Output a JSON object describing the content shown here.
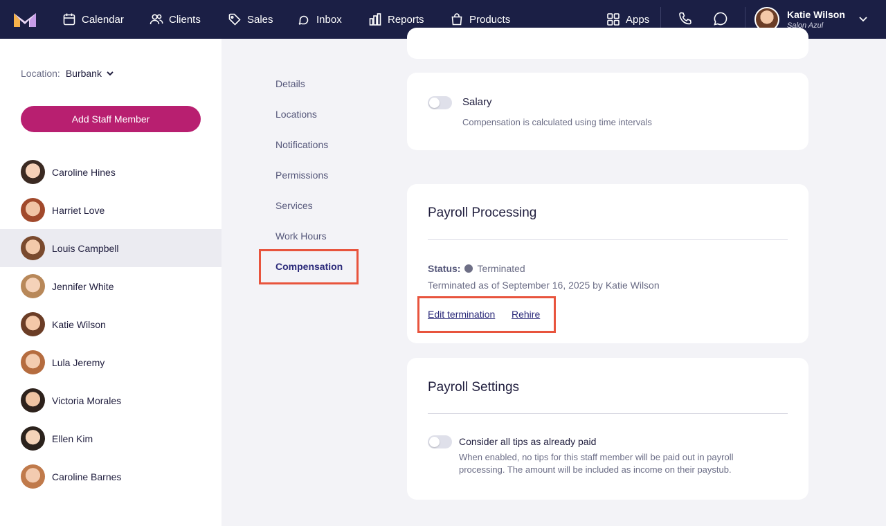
{
  "nav": {
    "items": [
      {
        "label": "Calendar",
        "icon": "calendar-icon"
      },
      {
        "label": "Clients",
        "icon": "clients-icon"
      },
      {
        "label": "Sales",
        "icon": "tag-icon"
      },
      {
        "label": "Inbox",
        "icon": "inbox-icon"
      },
      {
        "label": "Reports",
        "icon": "bar-chart-icon"
      },
      {
        "label": "Products",
        "icon": "shopping-bag-icon"
      }
    ],
    "apps_label": "Apps",
    "user": {
      "name": "Katie Wilson",
      "salon": "Salon Azul"
    }
  },
  "sidebar": {
    "location_label": "Location:",
    "location_value": "Burbank",
    "add_button": "Add Staff Member",
    "staff": [
      {
        "name": "Caroline Hines",
        "active": false,
        "skin": "#f6d1b8",
        "hair": "#3b2a22"
      },
      {
        "name": "Harriet Love",
        "active": false,
        "skin": "#f1c4a5",
        "hair": "#a1492b"
      },
      {
        "name": "Louis Campbell",
        "active": true,
        "skin": "#f3c9aa",
        "hair": "#7a4a2e"
      },
      {
        "name": "Jennifer White",
        "active": false,
        "skin": "#f5d2b9",
        "hair": "#b88859"
      },
      {
        "name": "Katie Wilson",
        "active": false,
        "skin": "#f4c8a8",
        "hair": "#6b3d26"
      },
      {
        "name": "Lula Jeremy",
        "active": false,
        "skin": "#f3ccb0",
        "hair": "#b56c3f"
      },
      {
        "name": "Victoria Morales",
        "active": false,
        "skin": "#efc3a2",
        "hair": "#2d211b"
      },
      {
        "name": "Ellen Kim",
        "active": false,
        "skin": "#f4d3b8",
        "hair": "#2b221c"
      },
      {
        "name": "Caroline Barnes",
        "active": false,
        "skin": "#f3cbb0",
        "hair": "#c07a4b"
      }
    ]
  },
  "settings_nav": {
    "items": [
      "Details",
      "Locations",
      "Notifications",
      "Permissions",
      "Services",
      "Work Hours",
      "Compensation"
    ],
    "active": "Compensation"
  },
  "salary_card": {
    "toggle_label": "Salary",
    "description": "Compensation is calculated using time intervals"
  },
  "payroll_processing": {
    "title": "Payroll Processing",
    "status_label": "Status:",
    "status_value": "Terminated",
    "terminated_note": "Terminated as of September 16, 2025 by Katie Wilson",
    "edit_link": "Edit termination",
    "rehire_link": "Rehire"
  },
  "payroll_settings": {
    "title": "Payroll Settings",
    "toggle_label": "Consider all tips as already paid",
    "description_line1": "When enabled, no tips for this staff member will be paid out in payroll",
    "description_line2": "processing. The amount will be included as income on their paystub."
  },
  "colors": {
    "nav_bg": "#1b1f45",
    "brand": "#b81f70",
    "highlight": "#e8543d"
  }
}
